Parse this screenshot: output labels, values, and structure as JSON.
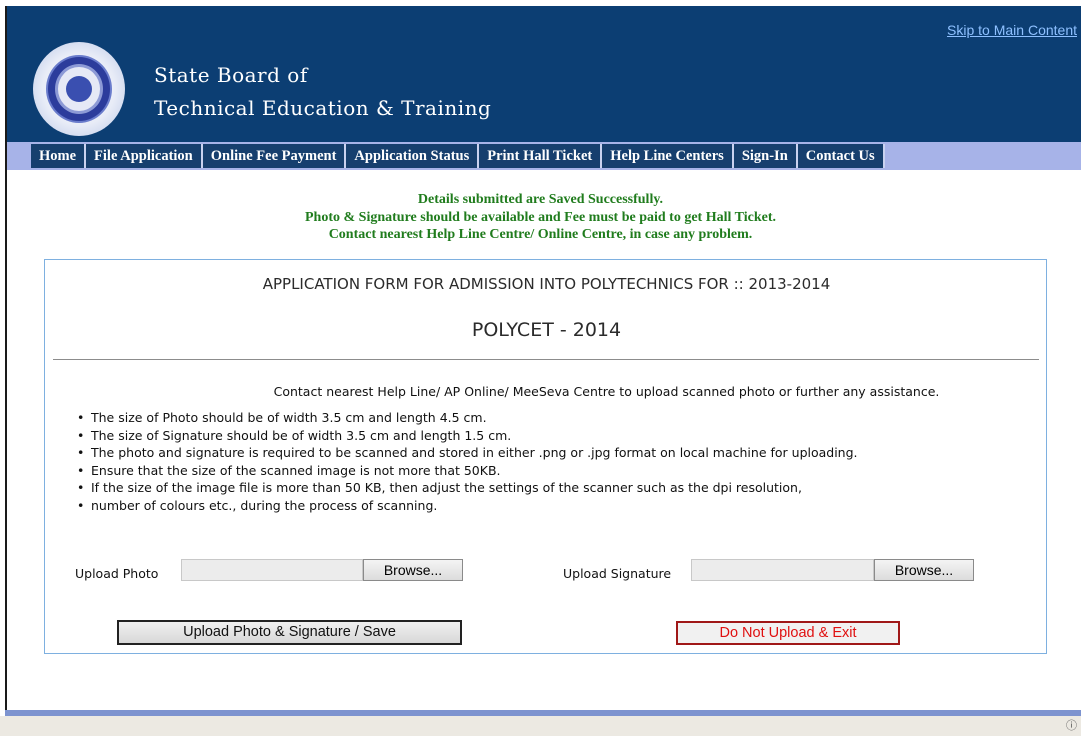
{
  "header": {
    "title_line1": "State Board of",
    "title_line2": "Technical Education & Training",
    "skip_link": "Skip to Main Content"
  },
  "nav": {
    "items": [
      {
        "label": "Home"
      },
      {
        "label": "File Application"
      },
      {
        "label": "Online Fee Payment"
      },
      {
        "label": "Application Status"
      },
      {
        "label": "Print Hall Ticket"
      },
      {
        "label": "Help Line Centers"
      },
      {
        "label": "Sign-In"
      },
      {
        "label": "Contact Us"
      }
    ]
  },
  "messages": {
    "line1": "Details submitted are Saved Successfully.",
    "line2": "Photo & Signature should be available and Fee must be paid to get Hall Ticket.",
    "line3": "Contact nearest Help Line Centre/ Online Centre, in case any problem."
  },
  "form": {
    "title": "APPLICATION FORM FOR ADMISSION INTO POLYTECHNICS FOR :: 2013-2014",
    "subtitle": "POLYCET - 2014",
    "contact_note": "Contact nearest Help Line/ AP Online/ MeeSeva Centre to upload scanned photo or further any assistance.",
    "rules": [
      "The size of Photo should be of width 3.5 cm and length 4.5 cm.",
      "The size of Signature should be of width 3.5 cm and length 1.5 cm.",
      "The photo and signature is required to be scanned and stored in either .png or .jpg format on local machine for uploading.",
      "Ensure that the size of the scanned image is not more that 50KB.",
      "If the size of the image file is more than 50 KB, then adjust the settings of the scanner such as the dpi resolution,",
      "number of colours etc., during the process of scanning."
    ],
    "upload_photo_label": "Upload Photo",
    "upload_signature_label": "Upload Signature",
    "browse_label": "Browse...",
    "save_button": "Upload Photo & Signature / Save",
    "exit_button": "Do Not Upload & Exit"
  },
  "colors": {
    "header_bg": "#0c3e73",
    "nav_bg": "#a7b3e8",
    "nav_item_bg": "#163f6e",
    "success_text": "#207c1d",
    "exit_text": "#e01010"
  },
  "icons": {
    "logo": "board-seal-logo",
    "status": "info-icon"
  }
}
